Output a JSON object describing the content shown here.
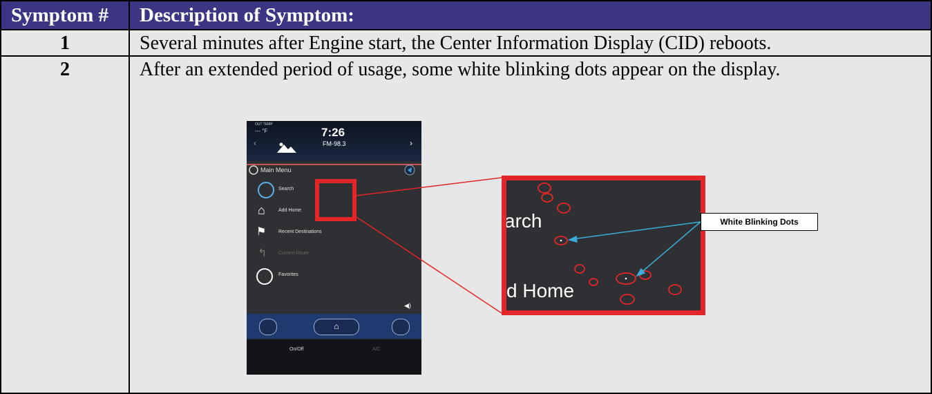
{
  "table": {
    "headers": [
      "Symptom #",
      "Description of Symptom:"
    ],
    "rows": [
      {
        "number": "1",
        "description": "Several minutes after Engine start, the Center Information Display (CID) reboots."
      },
      {
        "number": "2",
        "description": "After an extended period of usage, some white blinking dots appear on the display."
      }
    ]
  },
  "screenshot": {
    "out_temp_label": "OUT TEMP",
    "temp": "--- °F",
    "time": "7:26",
    "station": "FM-98.3",
    "menu_title": "Main Menu",
    "menu_items": [
      "Search",
      "Add Home",
      "Recent Destinations",
      "Current Route",
      "Favorites"
    ],
    "on_off": "On/Off",
    "ac": "A/C"
  },
  "zoom": {
    "text_search": "arch",
    "text_home": "d Home"
  },
  "callout": "White Blinking Dots",
  "colors": {
    "header_bg": "#3b3584",
    "cell_bg": "#e7e7e7",
    "highlight_red": "#e3262a",
    "arrow_blue": "#3aaed8"
  }
}
